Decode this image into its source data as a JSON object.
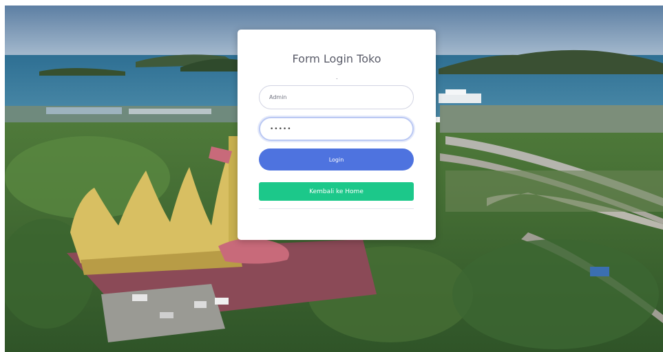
{
  "login_form": {
    "title": "Form Login Toko",
    "title_dot": ".",
    "username_value": "Admin",
    "password_value": "•••••",
    "login_label": "Login",
    "home_label": "Kembali ke Home"
  },
  "colors": {
    "login_button": "#4e73df",
    "home_button": "#1cc88a",
    "title_text": "#5a5c69"
  }
}
